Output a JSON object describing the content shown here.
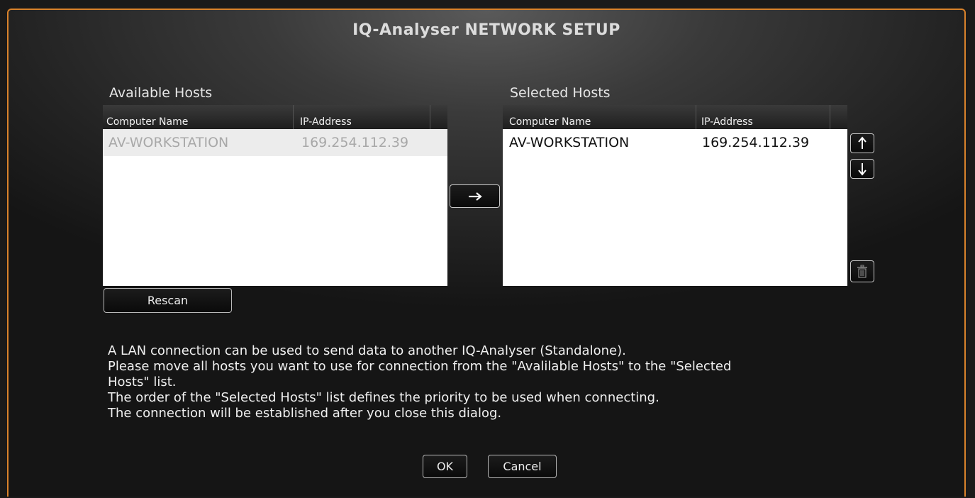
{
  "dialog": {
    "title": "IQ-Analyser NETWORK SETUP",
    "accent_color": "#d9822b"
  },
  "available_hosts": {
    "label": "Available Hosts",
    "columns": [
      "Computer Name",
      "IP-Address"
    ],
    "rows": [
      {
        "computer_name": "AV-WORKSTATION",
        "ip_address": "169.254.112.39",
        "state": "disabled"
      }
    ],
    "rescan_label": "Rescan"
  },
  "selected_hosts": {
    "label": "Selected Hosts",
    "columns": [
      "Computer Name",
      "IP-Address"
    ],
    "rows": [
      {
        "computer_name": "AV-WORKSTATION",
        "ip_address": "169.254.112.39",
        "state": "normal"
      }
    ]
  },
  "icons": {
    "move_right": "arrow-right-icon",
    "move_up": "arrow-up-icon",
    "move_down": "arrow-down-icon",
    "delete": "trash-icon"
  },
  "info_lines": [
    "A LAN connection can be used to send data to another IQ-Analyser (Standalone).",
    "Please move all hosts you want to use for connection from the \"Avalilable Hosts\" to the \"Selected",
    "Hosts\" list.",
    "The order of the \"Selected Hosts\" list defines the priority to be used when connecting.",
    "The connection will be established after you close this dialog."
  ],
  "buttons": {
    "ok": "OK",
    "cancel": "Cancel"
  }
}
